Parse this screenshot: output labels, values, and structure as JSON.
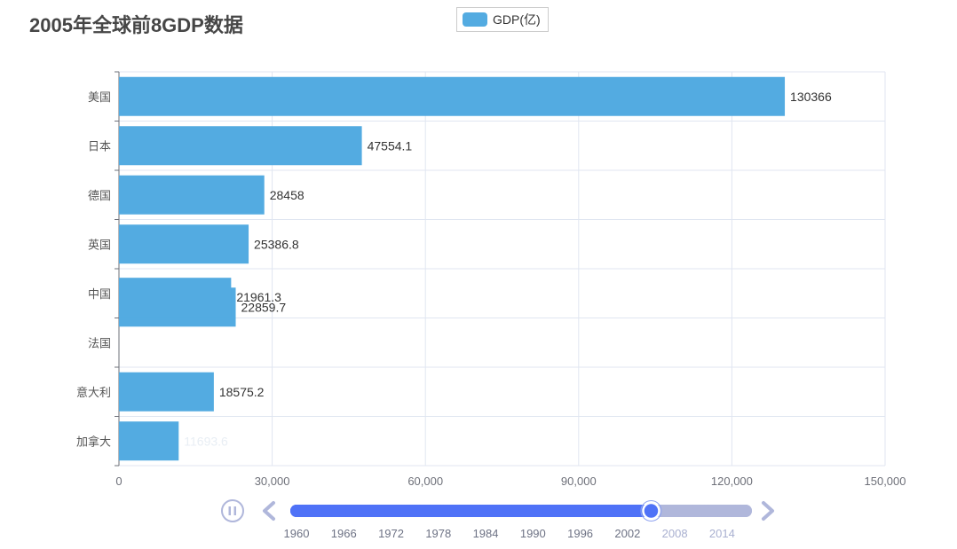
{
  "title": "2005年全球前8GDP数据",
  "legend": {
    "label": "GDP(亿)",
    "color": "#53abe1"
  },
  "chart_data": {
    "type": "bar",
    "orientation": "horizontal",
    "title": "2005年全球前8GDP数据",
    "categories": [
      "美国",
      "日本",
      "德国",
      "英国",
      "中国",
      "法国",
      "意大利",
      "加拿大"
    ],
    "series": [
      {
        "name": "GDP(亿)",
        "values": [
          130366,
          47554.1,
          28458,
          25386.8,
          22859.7,
          21961.3,
          18575.2,
          11693.6
        ],
        "labels": [
          "130366",
          "47554.1",
          "28458",
          "25386.8",
          "22859.7",
          "21961.3",
          "18575.2",
          "11693.6"
        ]
      }
    ],
    "xlim": [
      0,
      150000
    ],
    "xticks": [
      0,
      30000,
      60000,
      90000,
      120000,
      150000
    ],
    "xtick_labels": [
      "0",
      "30,000",
      "60,000",
      "90,000",
      "120,000",
      "150,000"
    ],
    "grid": true,
    "legend_position": "top-center",
    "colors": {
      "bar": "#53abe1",
      "axis": "#6e7079",
      "grid": "#e0e6f1"
    }
  },
  "timeline": {
    "play_icon": "pause-icon",
    "prev_icon": "chevron-left-icon",
    "next_icon": "chevron-right-icon",
    "start_year": 1960,
    "end_year": 2017,
    "current_year": 2005,
    "labels": [
      "1960",
      "1966",
      "1972",
      "1978",
      "1984",
      "1990",
      "1996",
      "2002",
      "2008",
      "2014"
    ],
    "active_color": "#4f72f7",
    "inactive_color": "#b0b7db"
  }
}
